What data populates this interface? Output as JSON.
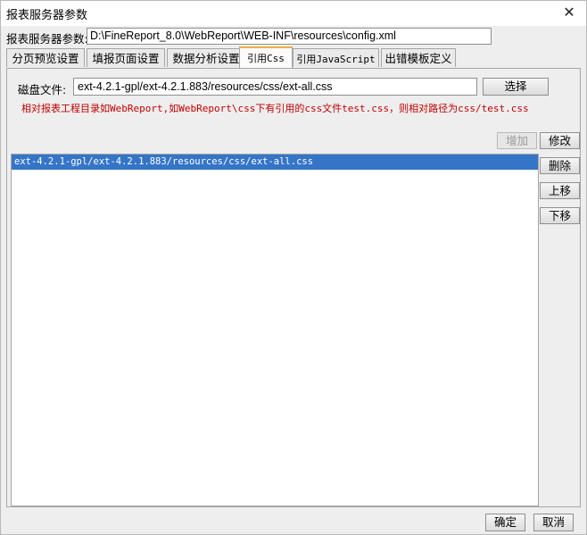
{
  "window": {
    "title": "报表服务器参数",
    "close_glyph": "✕"
  },
  "server_param": {
    "label": "报表服务器参数:",
    "value": "D:\\FineReport_8.0\\WebReport\\WEB-INF\\resources\\config.xml"
  },
  "tabs": [
    {
      "label": "分页预览设置",
      "active": false
    },
    {
      "label": "填报页面设置",
      "active": false
    },
    {
      "label": "数据分析设置",
      "active": false
    },
    {
      "label": "引用Css",
      "active": true
    },
    {
      "label": "引用JavaScript",
      "active": false
    },
    {
      "label": "出错模板定义",
      "active": false
    }
  ],
  "css_panel": {
    "disk_label": "磁盘文件:",
    "disk_value": "ext-4.2.1-gpl/ext-4.2.1.883/resources/css/ext-all.css",
    "choose_button": "选择",
    "hint": "相对报表工程目录如WebReport,如WebReport\\css下有引用的css文件test.css，则相对路径为css/test.css",
    "add_button": "增加",
    "modify_button": "修改",
    "delete_button": "删除",
    "move_up_button": "上移",
    "move_down_button": "下移",
    "items": [
      {
        "text": "ext-4.2.1-gpl/ext-4.2.1.883/resources/css/ext-all.css",
        "selected": true
      }
    ]
  },
  "footer": {
    "ok_button": "确定",
    "cancel_button": "取消"
  },
  "colors": {
    "selection": "#3575c8",
    "hint_text": "#c00000",
    "active_tab_accent": "#f0b040"
  }
}
